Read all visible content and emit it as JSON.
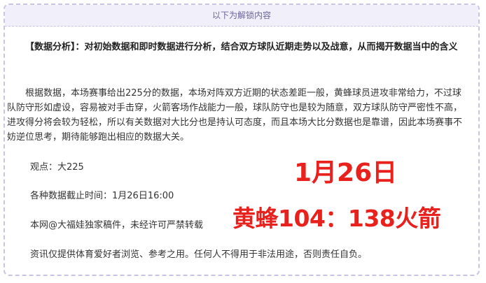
{
  "banner": {
    "text": "以下为解锁内容"
  },
  "analysis_heading": "【数据分析】：对初始数据和即时数据进行分析，结合双方球队近期走势以及战意，从而揭开数据当中的含义",
  "analysis_body": "根据数据，本场赛事给出225分的数据，本场对阵双方近期的状态差距一般，黄蜂球员进攻非常给力，不过球队防守形如虚设，容易被对手击穿，火箭客场作战能力一般，球队防守也是较为随意，双方球队防守严密性不高，进攻得分将会较为轻松，所以有关数据对大比分也是持认可态度，而且本场大比分数据也是靠谱，因此本场赛事不妨逆位思考，期待能够跑出相应的数据大关。",
  "viewpoint": "观点：大225",
  "deadline": "各种数据截止时间：1月26日16:00",
  "copyright": "本网@大福娃独家稿件，未经许可严禁转载",
  "disclaimer": "资讯仅提供体育爱好者浏览、参考之用。任何人不得用于非法用途，否则责任自负。",
  "highlight": {
    "date": "1月26日",
    "score": "黄蜂104：138火箭",
    "color": "#e8211d"
  }
}
